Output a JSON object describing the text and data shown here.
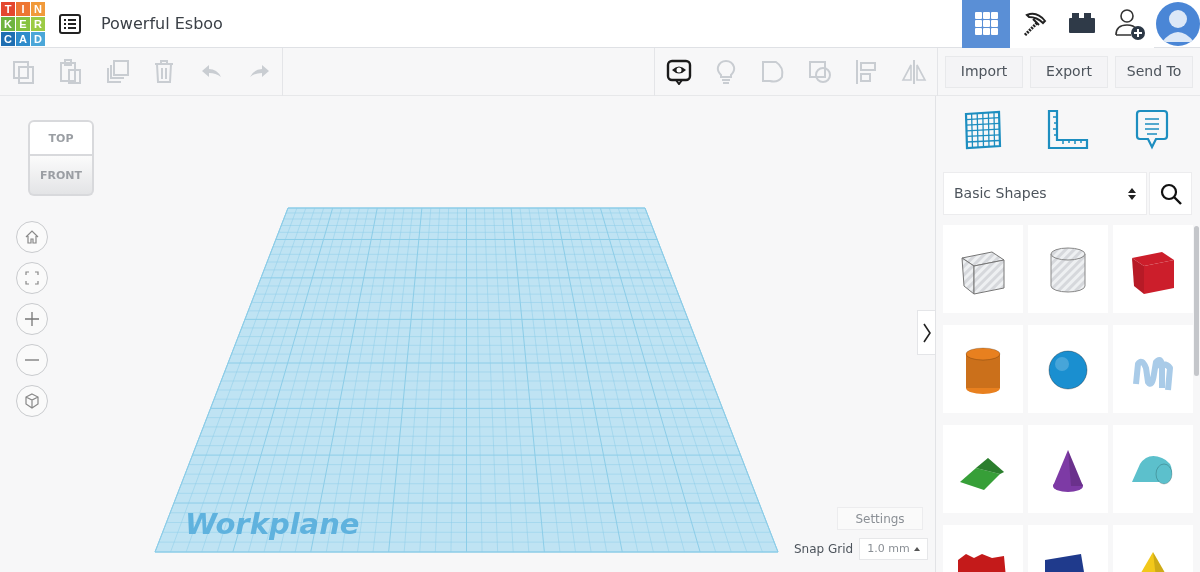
{
  "logo": {
    "tiles": [
      {
        "letter": "T",
        "color": "#e4472f"
      },
      {
        "letter": "I",
        "color": "#ee7633"
      },
      {
        "letter": "N",
        "color": "#f19a3a"
      },
      {
        "letter": "K",
        "color": "#6fb43f"
      },
      {
        "letter": "E",
        "color": "#86c240"
      },
      {
        "letter": "R",
        "color": "#9ccb45"
      },
      {
        "letter": "C",
        "color": "#1f6fb2"
      },
      {
        "letter": "A",
        "color": "#2f8ccb"
      },
      {
        "letter": "D",
        "color": "#4ba7d9"
      }
    ]
  },
  "design_title": "Powerful Esboo",
  "nav_buttons": [
    {
      "kind": "design",
      "selected": true
    },
    {
      "kind": "pickaxe",
      "selected": false
    },
    {
      "kind": "brick",
      "selected": false
    },
    {
      "kind": "invite",
      "selected": false
    }
  ],
  "toolbar": {
    "edit_tools": [
      {
        "kind": "copy",
        "disabled": true
      },
      {
        "kind": "paste",
        "disabled": true
      },
      {
        "kind": "duplicate",
        "disabled": true
      },
      {
        "kind": "delete",
        "disabled": true
      },
      {
        "kind": "undo",
        "disabled": true
      },
      {
        "kind": "redo",
        "disabled": true
      }
    ],
    "view_tools": [
      {
        "kind": "notes",
        "disabled": false
      },
      {
        "kind": "bulb",
        "disabled": true
      },
      {
        "kind": "solid",
        "disabled": true
      },
      {
        "kind": "hole",
        "disabled": true
      },
      {
        "kind": "align",
        "disabled": true
      },
      {
        "kind": "mirror",
        "disabled": true
      }
    ],
    "actions": [
      "Import",
      "Export",
      "Send To"
    ]
  },
  "view_cube": {
    "top": "TOP",
    "front": "FRONT"
  },
  "view_controls": [
    {
      "kind": "home"
    },
    {
      "kind": "fit"
    },
    {
      "kind": "zoom_in"
    },
    {
      "kind": "zoom_out"
    },
    {
      "kind": "ortho"
    }
  ],
  "workplane": {
    "label": "Workplane"
  },
  "settings_button": "Settings",
  "snap_grid": {
    "label": "Snap Grid",
    "value": "1.0 mm"
  },
  "panel": {
    "tools": [
      {
        "kind": "grid"
      },
      {
        "kind": "ruler"
      },
      {
        "kind": "notes"
      }
    ],
    "category": "Basic Shapes",
    "shapes": [
      {
        "kind": "box_hole"
      },
      {
        "kind": "cylinder_hole"
      },
      {
        "kind": "box",
        "color": "#cc1e2b"
      },
      {
        "kind": "cylinder",
        "color": "#e8801f"
      },
      {
        "kind": "sphere",
        "color": "#1a8fd0"
      },
      {
        "kind": "scribble",
        "color": "#a9cbe8"
      },
      {
        "kind": "roof",
        "color": "#3aa83c"
      },
      {
        "kind": "cone",
        "color": "#7d3aa5"
      },
      {
        "kind": "round_roof",
        "color": "#5cc0cc"
      },
      {
        "kind": "text",
        "color": "#c41a1a"
      },
      {
        "kind": "wedge",
        "color": "#1f3a8c"
      },
      {
        "kind": "pyramid",
        "color": "#f2c81a"
      }
    ]
  }
}
